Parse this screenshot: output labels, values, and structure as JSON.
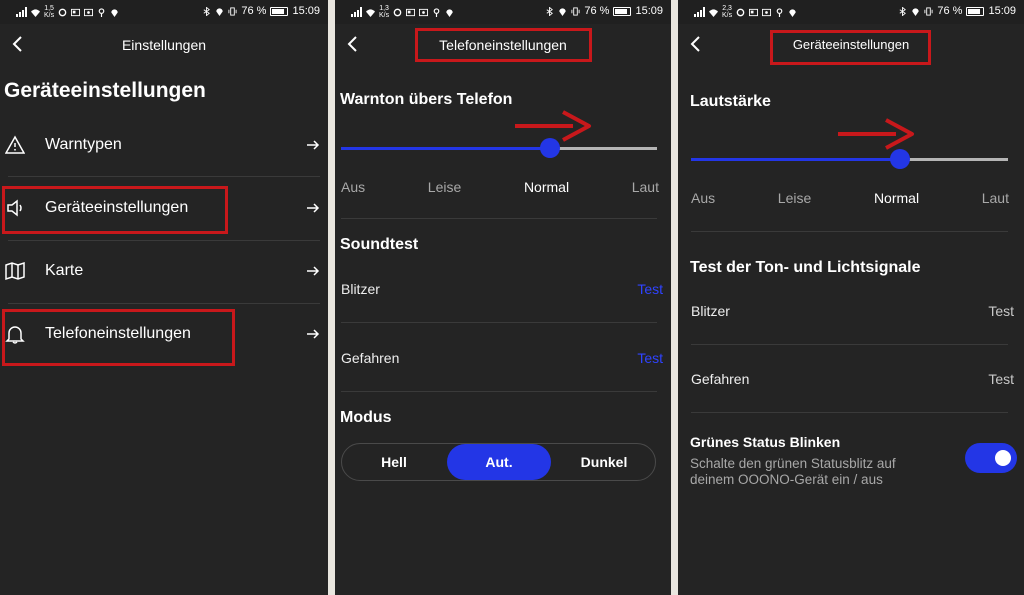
{
  "status_bars": [
    {
      "speed_value": "1,5",
      "speed_unit": "K/s",
      "battery": "76 %",
      "time": "15:09"
    },
    {
      "speed_value": "1,3",
      "speed_unit": "K/s",
      "battery": "76 %",
      "time": "15:09"
    },
    {
      "speed_value": "2,3",
      "speed_unit": "K/s",
      "battery": "76 %",
      "time": "15:09"
    }
  ],
  "screen1": {
    "nav_title": "Einstellungen",
    "page_title": "Geräteeinstellungen",
    "menu": [
      {
        "label": "Warntypen",
        "icon": "warning-icon"
      },
      {
        "label": "Geräteeinstellungen",
        "icon": "speaker-icon"
      },
      {
        "label": "Karte",
        "icon": "map-icon"
      },
      {
        "label": "Telefoneinstellungen",
        "icon": "bell-icon"
      }
    ]
  },
  "screen2": {
    "nav_title": "Telefoneinstellungen",
    "volume_title": "Warnton übers Telefon",
    "volume_levels": [
      "Aus",
      "Leise",
      "Normal",
      "Laut"
    ],
    "volume_selected": "Normal",
    "volume_fraction": 0.66,
    "soundtest_title": "Soundtest",
    "rows": [
      {
        "label": "Blitzer",
        "action": "Test"
      },
      {
        "label": "Gefahren",
        "action": "Test"
      }
    ],
    "mode_title": "Modus",
    "modes": [
      "Hell",
      "Aut.",
      "Dunkel"
    ],
    "mode_selected": "Aut."
  },
  "screen3": {
    "nav_title": "Geräteeinstellungen",
    "volume_title": "Lautstärke",
    "volume_levels": [
      "Aus",
      "Leise",
      "Normal",
      "Laut"
    ],
    "volume_selected": "Normal",
    "volume_fraction": 0.66,
    "test_title": "Test der Ton- und Lichtsignale",
    "rows": [
      {
        "label": "Blitzer",
        "action": "Test"
      },
      {
        "label": "Gefahren",
        "action": "Test"
      }
    ],
    "blink_title": "Grünes Status Blinken",
    "blink_desc_line1": "Schalte den grünen Statusblitz auf",
    "blink_desc_line2": "deinem OOONO-Gerät ein / aus",
    "blink_enabled": true
  },
  "colors": {
    "accent": "#2336e6",
    "annotation_red": "#c8181b",
    "background": "#242424",
    "slider_track": "#b5b5b5"
  }
}
